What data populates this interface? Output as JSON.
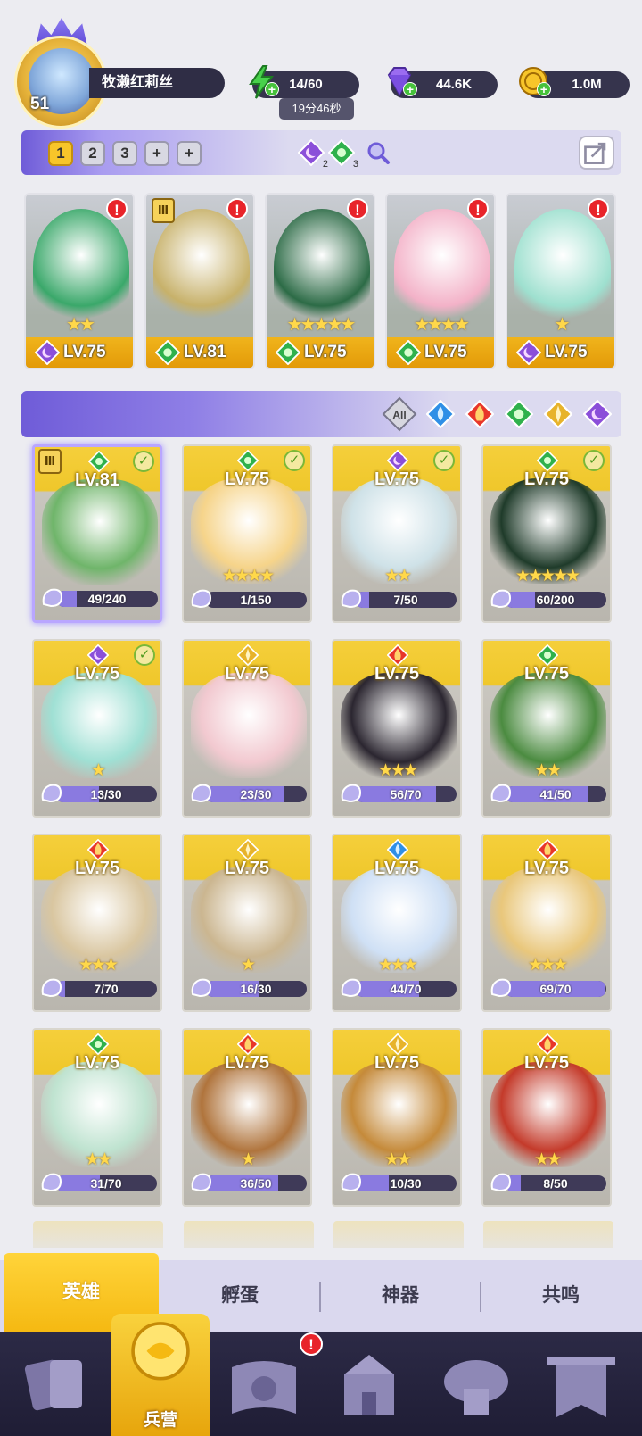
{
  "player": {
    "level": "51",
    "name": "牧濑红莉丝"
  },
  "resources": {
    "energy": "14/60",
    "energy_timer": "19分46秒",
    "gems": "44.6K",
    "gold": "1.0M"
  },
  "team_bar": {
    "slots": [
      "1",
      "2",
      "3",
      "+",
      "+"
    ],
    "active_slot": "1",
    "element_counts": [
      {
        "element": "dark",
        "count": "2"
      },
      {
        "element": "nature",
        "count": "3"
      }
    ]
  },
  "team": [
    {
      "level": "LV.75",
      "element": "dark",
      "stars": "★★",
      "alert": "!"
    },
    {
      "level": "LV.81",
      "element": "nature",
      "stars": "",
      "alert": "!",
      "tier": "Ⅲ"
    },
    {
      "level": "LV.75",
      "element": "nature",
      "stars": "★★★★★",
      "alert": "!"
    },
    {
      "level": "LV.75",
      "element": "nature",
      "stars": "★★★★",
      "alert": "!"
    },
    {
      "level": "LV.75",
      "element": "dark",
      "stars": "★",
      "alert": "!"
    }
  ],
  "filter": {
    "all_label": "All",
    "elements": [
      "water",
      "fire",
      "nature",
      "light",
      "dark"
    ]
  },
  "heroes": [
    {
      "level": "LV.81",
      "element": "nature",
      "stars": "",
      "shards": "49/240",
      "progress": 0.2,
      "checked": true,
      "tier": "Ⅲ"
    },
    {
      "level": "LV.75",
      "element": "nature",
      "stars": "★★★★",
      "shards": "1/150",
      "progress": 0.01,
      "checked": true
    },
    {
      "level": "LV.75",
      "element": "dark",
      "stars": "★★",
      "shards": "7/50",
      "progress": 0.14,
      "checked": true
    },
    {
      "level": "LV.75",
      "element": "nature",
      "stars": "★★★★★",
      "shards": "60/200",
      "progress": 0.3,
      "checked": true
    },
    {
      "level": "LV.75",
      "element": "dark",
      "stars": "★",
      "shards": "13/30",
      "progress": 0.43,
      "checked": true
    },
    {
      "level": "LV.75",
      "element": "light",
      "stars": "",
      "shards": "23/30",
      "progress": 0.77,
      "checked": false
    },
    {
      "level": "LV.75",
      "element": "fire",
      "stars": "★★★",
      "shards": "56/70",
      "progress": 0.8,
      "checked": false
    },
    {
      "level": "LV.75",
      "element": "nature",
      "stars": "★★",
      "shards": "41/50",
      "progress": 0.82,
      "checked": false
    },
    {
      "level": "LV.75",
      "element": "fire",
      "stars": "★★★",
      "shards": "7/70",
      "progress": 0.1,
      "checked": false
    },
    {
      "level": "LV.75",
      "element": "light",
      "stars": "★",
      "shards": "16/30",
      "progress": 0.53,
      "checked": false
    },
    {
      "level": "LV.75",
      "element": "water",
      "stars": "★★★",
      "shards": "44/70",
      "progress": 0.63,
      "checked": false
    },
    {
      "level": "LV.75",
      "element": "fire",
      "stars": "★★★",
      "shards": "69/70",
      "progress": 0.99,
      "checked": false
    },
    {
      "level": "LV.75",
      "element": "nature",
      "stars": "★★",
      "shards": "31/70",
      "progress": 0.44,
      "checked": false
    },
    {
      "level": "LV.75",
      "element": "fire",
      "stars": "★",
      "shards": "36/50",
      "progress": 0.72,
      "checked": false
    },
    {
      "level": "LV.75",
      "element": "light",
      "stars": "★★",
      "shards": "10/30",
      "progress": 0.33,
      "checked": false
    },
    {
      "level": "LV.75",
      "element": "fire",
      "stars": "★★",
      "shards": "8/50",
      "progress": 0.16,
      "checked": false
    }
  ],
  "sub_tabs": {
    "heroes": "英雄",
    "hatch": "孵蛋",
    "artifact": "神器",
    "resonance": "共鸣"
  },
  "nav": {
    "barracks": "兵营",
    "alert": "!"
  },
  "colors": {
    "water": "#2f8fe6",
    "fire": "#e8362a",
    "nature": "#2fb14c",
    "light": "#e7b32a",
    "dark": "#8b4fd9",
    "accent_gold": "#f5b912",
    "accent_purple": "#6f5cd8"
  }
}
